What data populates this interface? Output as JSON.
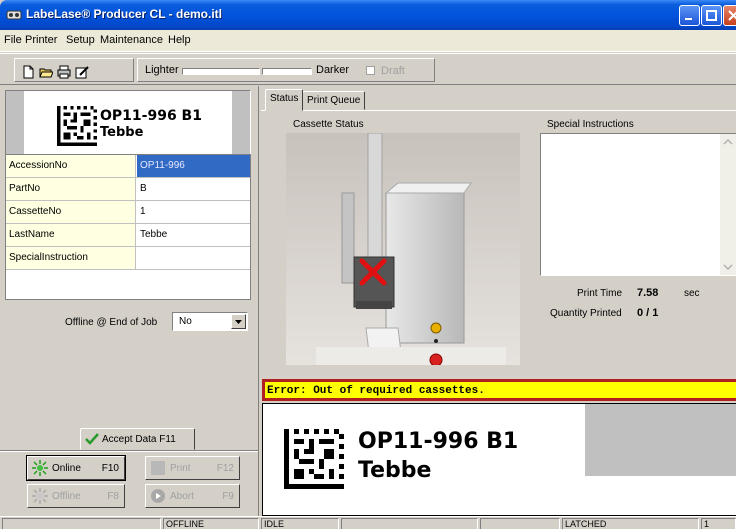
{
  "window": {
    "title": "LabeLase® Producer CL - demo.itl"
  },
  "menu": {
    "items": [
      "File",
      "Printer",
      "Setup",
      "Maintenance",
      "Help"
    ]
  },
  "toolbar": {
    "icons": [
      "new-file-icon",
      "open-folder-icon",
      "print-icon",
      "edit-icon"
    ],
    "lighter_label": "Lighter",
    "darker_label": "Darker",
    "draft_label": "Draft"
  },
  "label_card": {
    "line1": "OP11-996  B1",
    "line2": "Tebbe"
  },
  "fields": [
    {
      "key": "AccessionNo",
      "value": "OP11-996",
      "selected": true
    },
    {
      "key": "PartNo",
      "value": "B"
    },
    {
      "key": "CassetteNo",
      "value": "1"
    },
    {
      "key": "LastName",
      "value": "Tebbe"
    },
    {
      "key": "SpecialInstruction",
      "value": ""
    }
  ],
  "offline_end_job": {
    "label": "Offline @ End of Job",
    "value": "No"
  },
  "accept_tab": {
    "label": "Accept Data",
    "key": "F11"
  },
  "buttons": {
    "online": {
      "label": "Online",
      "key": "F10"
    },
    "print": {
      "label": "Print",
      "key": "F12"
    },
    "offline": {
      "label": "Offline",
      "key": "F8"
    },
    "abort": {
      "label": "Abort",
      "key": "F9"
    }
  },
  "tabs": [
    {
      "label": "Status",
      "active": true
    },
    {
      "label": "Print Queue",
      "active": false
    }
  ],
  "status_panel": {
    "cassette_status_label": "Cassette Status",
    "special_instructions_label": "Special Instructions",
    "print_time_label": "Print Time",
    "print_time_value": "7.58",
    "print_time_unit": "sec",
    "quantity_label": "Quantity Printed",
    "quantity_value": "0 / 1"
  },
  "error": {
    "message": "Error: Out of required cassettes."
  },
  "preview": {
    "line1": "OP11-996  B1",
    "line2": "Tebbe"
  },
  "statusbar": {
    "panels": [
      "",
      "OFFLINE",
      "IDLE",
      "",
      "",
      "LATCHED",
      "1"
    ]
  },
  "colors": {
    "titlebar": "#0254de",
    "error_bg": "#ffff00",
    "error_border": "#b02020",
    "selection": "#316ac5",
    "key_cell": "#ffffe1"
  }
}
